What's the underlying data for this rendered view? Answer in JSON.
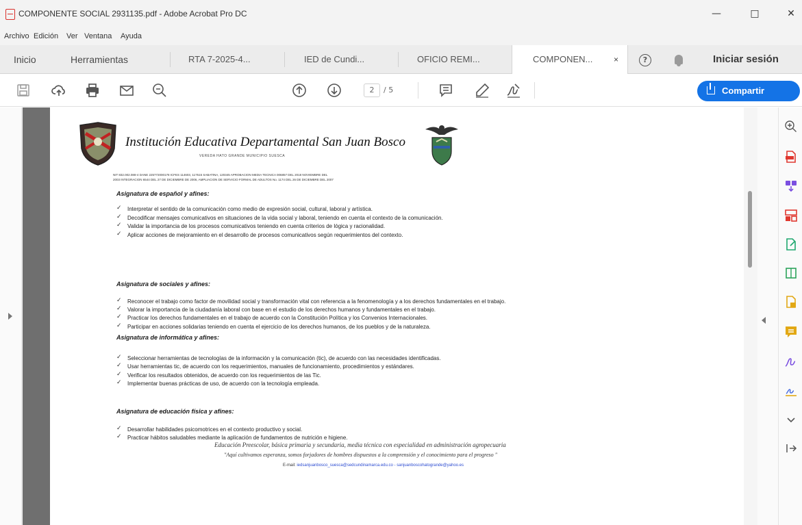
{
  "window": {
    "title": "COMPONENTE SOCIAL 2931135.pdf - Adobe Acrobat Pro DC"
  },
  "menu": [
    "Archivo",
    "Edición",
    "Ver",
    "Ventana",
    "Ayuda"
  ],
  "tabs": {
    "home": "Inicio",
    "tools": "Herramientas",
    "docs": [
      {
        "label": "RTA 7-2025-4..."
      },
      {
        "label": "IED de Cundi..."
      },
      {
        "label": "OFICIO REMI..."
      },
      {
        "label": "COMPONEN...",
        "active": true
      }
    ],
    "close_glyph": "×",
    "help_glyph": "?",
    "signin": "Iniciar sesión"
  },
  "toolbar": {
    "page_current": "2",
    "page_total": "/ 5",
    "share_label": "Compartir"
  },
  "document": {
    "institution_name": "Institución Educativa Departamental San Juan Bosco",
    "institution_sub": "VEREDA HATO GRANDE MUNICIPIO SUESCA",
    "resolution_line1": "NIT 832.002.088-4 DANE 225772000178 ICFES 114603, 117515 SABATINA, 120345 APROBACION MEDIA TECNICA 006857 DEL 2018 NOVIEMBRE DEL",
    "resolution_line2": "2003 INTEGRACION 6544 DEL 27 DE DICIEMBRE DE 2006, AMPLIACION DE SERVICIO FORMAL DE ADULTOS No. 1174 DEL 26 DE DICIEMBRE DEL 2007",
    "sections": [
      {
        "heading": "Asignatura de español y afines:",
        "items": [
          "Interpretar el sentido de la comunicación como medio de expresión social, cultural, laboral y artística.",
          "Decodificar mensajes comunicativos en situaciones de la vida social y laboral, teniendo en cuenta el contexto de la comunicación.",
          "Validar la importancia de los procesos comunicativos teniendo en cuenta criterios de lógica y racionalidad.",
          "Aplicar acciones de mejoramiento en el desarrollo de procesos comunicativos según requerimientos del contexto."
        ]
      },
      {
        "heading": "Asignatura de sociales y afines:",
        "items": [
          "Reconocer el trabajo como factor de movilidad social y transformación vital con referencia a la fenomenología y a los derechos fundamentales en el trabajo.",
          "Valorar la importancia de la ciudadanía laboral con base en el estudio de los derechos humanos y fundamentales en el trabajo.",
          "Practicar los derechos fundamentales en el trabajo de acuerdo con la Constitución Política y los Convenios Internacionales.",
          "Participar en acciones solidarias teniendo en cuenta el ejercicio de los derechos humanos, de los pueblos y de la naturaleza."
        ]
      },
      {
        "heading": "Asignatura de informática y afines:",
        "items": [
          "Seleccionar herramientas de tecnologías de la información y la comunicación (tic), de acuerdo con las necesidades identificadas.",
          "Usar herramientas tic, de acuerdo con los requerimientos, manuales de funcionamiento, procedimientos y estándares.",
          "Verificar los resultados obtenidos, de acuerdo con los requerimientos de las Tic.",
          "Implementar buenas prácticas de uso, de acuerdo con la tecnología empleada."
        ]
      },
      {
        "heading": "Asignatura de educación física y afines:",
        "items": [
          "Desarrollar habilidades psicomotrices en el contexto productivo y social.",
          "Practicar hábitos saludables mediante la aplicación de fundamentos de nutrición e higiene."
        ]
      }
    ],
    "footer_line1": "Educación Preescolar, básica primaria y secundaria, media técnica con especialidad en administración agropecuaria",
    "footer_line2": "\"Aquí cultivamos esperanza, somos forjadores de hombres dispuestos a la comprensión y el conocimiento para el progreso \"",
    "footer_email_label": "E-mail:",
    "footer_email": "iedsanjuanbosco_suesca@sedcundinamarca.edu.co - sanjuanboscohatogrande@yahoo.es"
  },
  "colors": {
    "accent": "#1473e6",
    "acrobat_red": "#d9302c"
  }
}
